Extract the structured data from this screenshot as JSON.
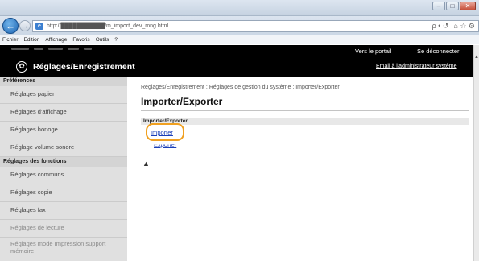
{
  "browser": {
    "url": "http://███████████/m_import_dev_mng.html",
    "address_icons": "ρ • ↺",
    "toolbar_icons": "⌂ ☆ ⚙",
    "menu": [
      "Fichier",
      "Edition",
      "Affichage",
      "Favoris",
      "Outils",
      "?"
    ]
  },
  "header": {
    "title": "Réglages/Enregistrement",
    "portal_link": "Vers le portail",
    "logout_link": "Se déconnecter",
    "admin_email_link": "Email à l'administrateur système"
  },
  "sidebar": {
    "preferences_heading": "Préférences",
    "preferences_items": [
      "Réglages papier",
      "Réglages d'affichage",
      "Réglages horloge",
      "Réglage volume sonore"
    ],
    "functions_heading": "Réglages des fonctions",
    "functions_items": [
      "Réglages communs",
      "Réglages copie",
      "Réglages fax",
      "Réglages de lecture",
      "Réglages mode Impression support mémoire"
    ]
  },
  "main": {
    "breadcrumb": "Réglages/Enregistrement : Réglages de gestion du système : Importer/Exporter",
    "page_title": "Importer/Exporter",
    "section_heading": "Importer/Exporter",
    "import_link": "Importer",
    "export_link": "Exporter",
    "top_icon": "▲"
  },
  "colors": {
    "header_bg": "#000000",
    "sidebar_bg": "#e0e0e0",
    "highlight": "#f0a020",
    "link": "#1a3fb8"
  }
}
